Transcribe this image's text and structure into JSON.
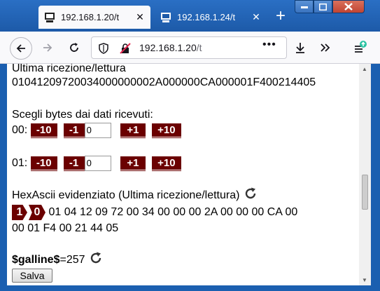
{
  "browser": {
    "tabs": [
      {
        "title": "192.168.1.20/t",
        "active": true
      },
      {
        "title": "192.168.1.24/t",
        "active": false
      }
    ],
    "url_host": "192.168.1.20",
    "url_path": "/t",
    "url_menu": "•••",
    "new_tab_label": "+",
    "close_tab_label": "✕"
  },
  "page": {
    "last_read_label": "Ultima ricezione/lettura",
    "last_read_value": "01041209720034000000002A000000CA000001F400214405",
    "choose_label": "Scegli bytes dai dati ricevuti:",
    "rows": [
      {
        "label": "00:",
        "value": "0"
      },
      {
        "label": "01:",
        "value": "0"
      }
    ],
    "btn_minus10": "-10",
    "btn_minus1": "-1",
    "btn_plus1": "+1",
    "btn_plus10": "+10",
    "hex_label": "HexAscii evidenziato (Ultima ricezione/lettura)",
    "hex_badges": [
      "1",
      "0"
    ],
    "hex_line1": "01 04 12 09 72 00 34 00 00 00 2A 00 00 00 CA 00",
    "hex_line2": "00 01 F4 00 21 44 05",
    "var_name": "$galline$",
    "var_value": "=257",
    "save_label": "Salva"
  },
  "colors": {
    "titlebar": "#1d5aa8",
    "button_bg": "#6b0000",
    "close_btn": "#c14432"
  }
}
